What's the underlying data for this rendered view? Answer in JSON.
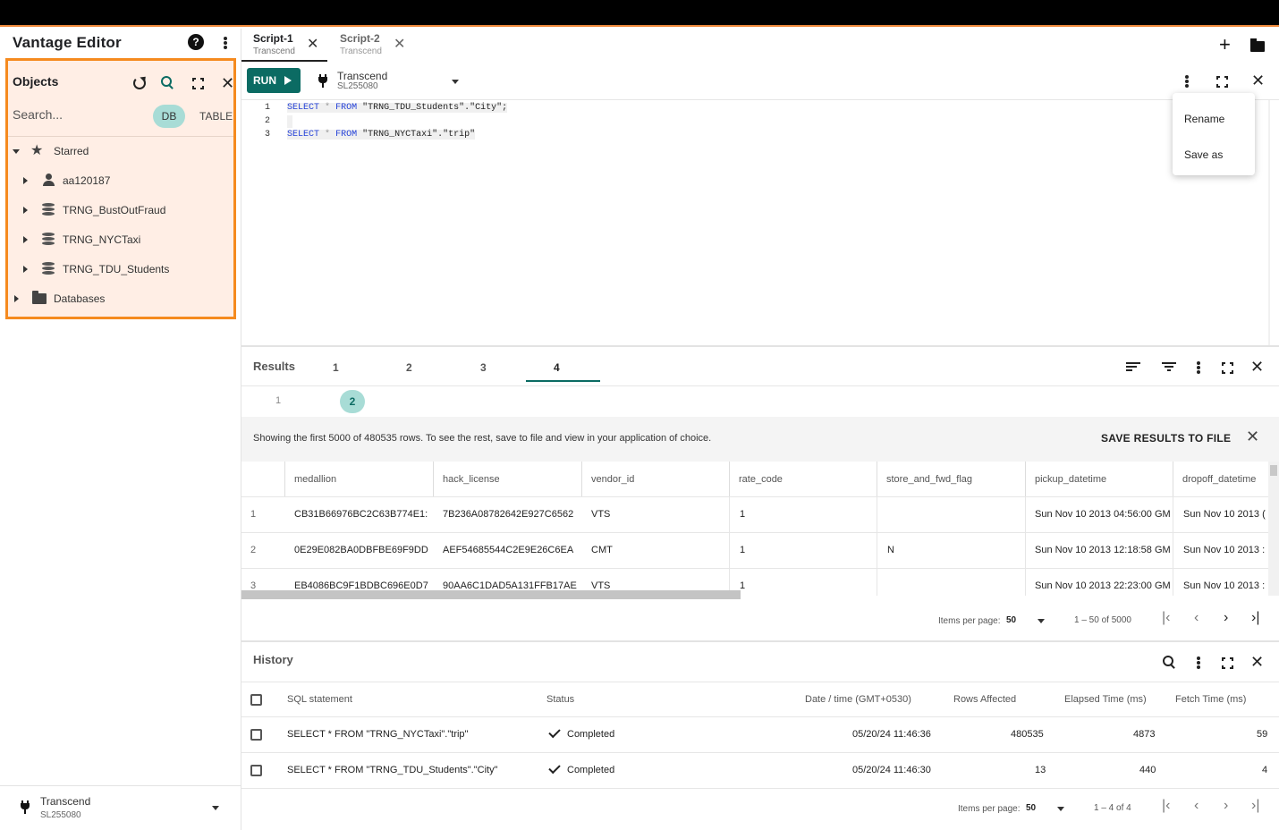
{
  "app": {
    "title": "Vantage Editor",
    "help_glyph": "?"
  },
  "objects": {
    "title": "Objects",
    "search_placeholder": "Search...",
    "chips": {
      "db": "DB",
      "table": "TABLE"
    },
    "tree": [
      {
        "label": "Starred",
        "icon": "star-icon",
        "expanded": true
      },
      {
        "label": "aa120187",
        "icon": "person-icon"
      },
      {
        "label": "TRNG_BustOutFraud",
        "icon": "database-icon"
      },
      {
        "label": "TRNG_NYCTaxi",
        "icon": "database-icon"
      },
      {
        "label": "TRNG_TDU_Students",
        "icon": "database-icon"
      },
      {
        "label": "Databases",
        "icon": "folder-icon"
      }
    ]
  },
  "connection": {
    "name": "Transcend",
    "id": "SL255080"
  },
  "tabs": [
    {
      "title": "Script-1",
      "sub": "Transcend",
      "active": true
    },
    {
      "title": "Script-2",
      "sub": "Transcend",
      "active": false
    }
  ],
  "toolbar": {
    "run_label": "RUN",
    "conn_name": "Transcend",
    "conn_id": "SL255080"
  },
  "editor": {
    "lines": [
      {
        "num": "1",
        "kw1": "SELECT",
        "op": "*",
        "kw2": "FROM",
        "rest": "\"TRNG_TDU_Students\".\"City\";"
      },
      {
        "num": "2"
      },
      {
        "num": "3",
        "kw1": "SELECT",
        "op": "*",
        "kw2": "FROM",
        "rest": "\"TRNG_NYCTaxi\".\"trip\""
      }
    ]
  },
  "context_menu": {
    "items": [
      "Rename",
      "Save as"
    ]
  },
  "results": {
    "title": "Results",
    "tabs": [
      "1",
      "2",
      "3",
      "4"
    ],
    "active_tab": "4",
    "sub_tabs": [
      "1",
      "2"
    ],
    "notice": "Showing the first 5000 of 480535 rows. To see the rest, save to file and view in your application of choice.",
    "save_label": "SAVE RESULTS TO FILE",
    "columns": [
      "medallion",
      "hack_license",
      "vendor_id",
      "rate_code",
      "store_and_fwd_flag",
      "pickup_datetime",
      "dropoff_datetime"
    ],
    "rows": [
      {
        "n": "1",
        "cells": [
          "CB31B66976BC2C63B774E1:",
          "7B236A08782642E927C6562",
          "VTS",
          "1",
          "",
          "Sun Nov 10 2013 04:56:00 GM",
          "Sun Nov 10 2013 ("
        ]
      },
      {
        "n": "2",
        "cells": [
          "0E29E082BA0DBFBE69F9DD",
          "AEF54685544C2E9E26C6EA",
          "CMT",
          "1",
          "N",
          "Sun Nov 10 2013 12:18:58 GM",
          "Sun Nov 10 2013 :"
        ]
      },
      {
        "n": "3",
        "cells": [
          "EB4086BC9F1BDBC696E0D7",
          "90AA6C1DAD5A131FFB17AE",
          "VTS",
          "1",
          "",
          "Sun Nov 10 2013 22:23:00 GM",
          "Sun Nov 10 2013 :"
        ]
      }
    ],
    "pager": {
      "items_label": "Items per page:",
      "items_value": "50",
      "range": "1 – 50 of 5000"
    }
  },
  "history": {
    "title": "History",
    "columns": [
      "SQL statement",
      "Status",
      "Date / time (GMT+0530)",
      "Rows Affected",
      "Elapsed Time (ms)",
      "Fetch Time (ms)"
    ],
    "rows": [
      {
        "sql": "SELECT * FROM \"TRNG_NYCTaxi\".\"trip\"",
        "status": "Completed",
        "date": "05/20/24 11:46:36",
        "rows": "480535",
        "elapsed": "4873",
        "fetch": "59"
      },
      {
        "sql": "SELECT * FROM \"TRNG_TDU_Students\".\"City\"",
        "status": "Completed",
        "date": "05/20/24 11:46:30",
        "rows": "13",
        "elapsed": "440",
        "fetch": "4"
      }
    ],
    "pager": {
      "items_label": "Items per page:",
      "items_value": "50",
      "range": "1 – 4 of 4"
    }
  },
  "colors": {
    "accent": "#0b6b63",
    "highlight": "#f58a1f",
    "panel_bg": "#ffeee5",
    "chip": "#a8dcd6"
  }
}
